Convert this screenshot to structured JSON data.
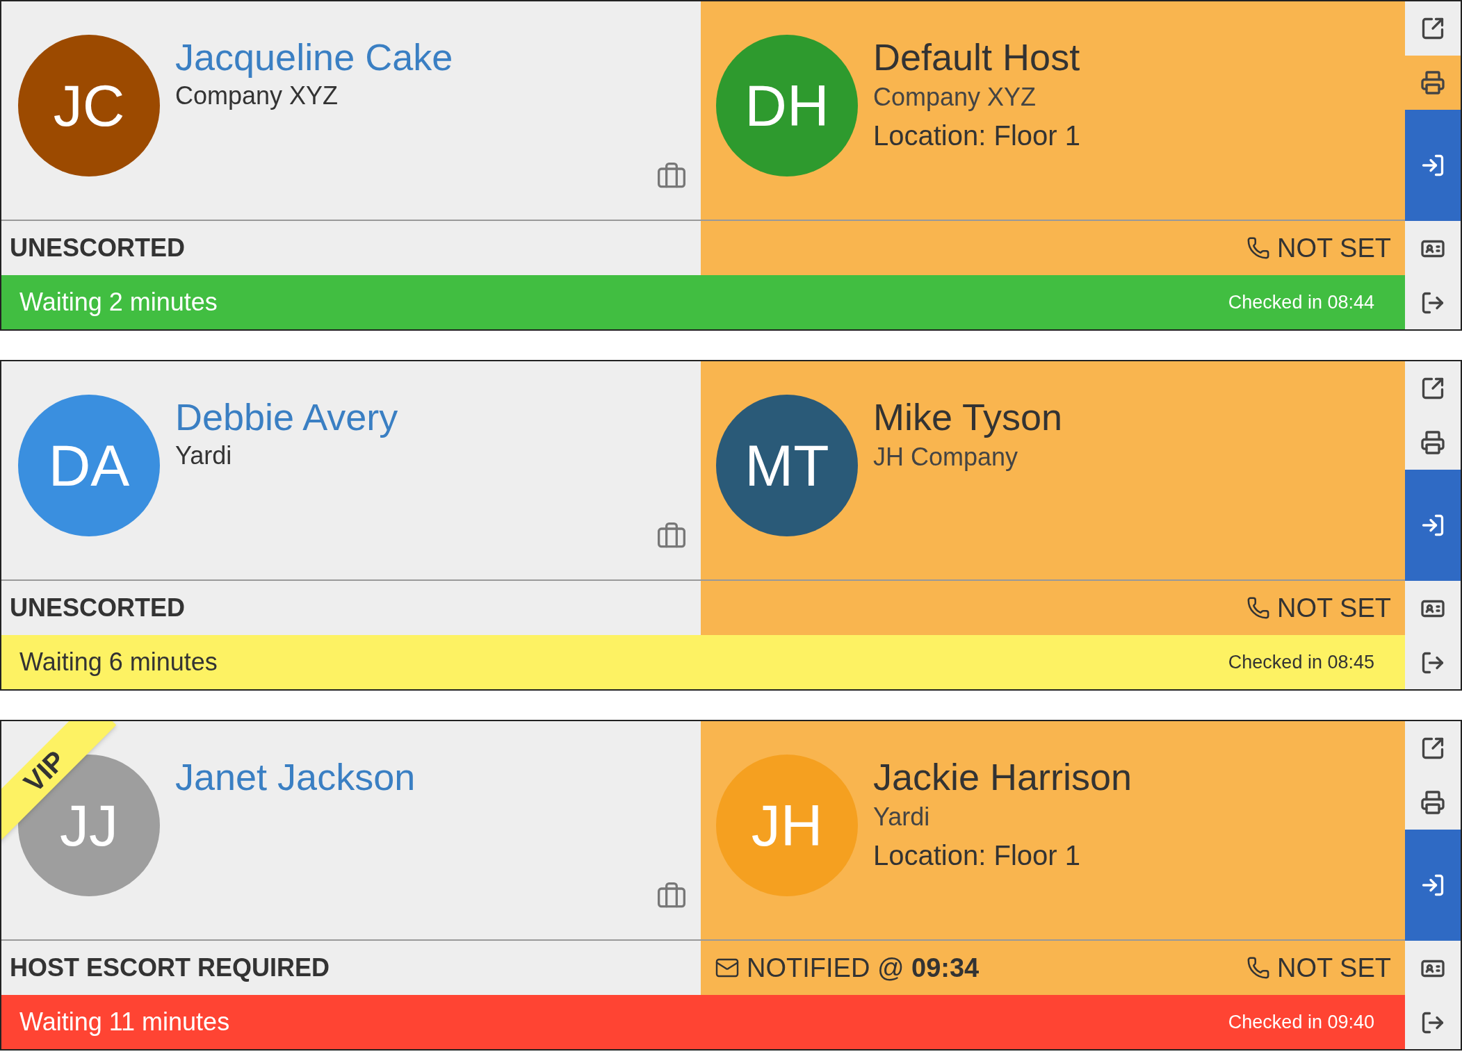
{
  "cards": [
    {
      "visitor": {
        "initials": "JC",
        "color": "#9c4a00",
        "name": "Jacqueline Cake",
        "company": "Company XYZ",
        "vip": false
      },
      "escort": "UNESCORTED",
      "host": {
        "initials": "DH",
        "color": "#2e9a2e",
        "name": "Default Host",
        "company": "Company XYZ",
        "location": "Location: Floor 1",
        "phone": "NOT SET"
      },
      "waiting": {
        "text": "Waiting 2 minutes",
        "checked_in": "Checked in 08:44",
        "color": "#41be41"
      },
      "actions": [
        {
          "kind": "edit",
          "highlighted": false
        },
        {
          "kind": "print",
          "highlighted": true
        },
        {
          "kind": "check-in",
          "highlighted": false
        },
        {
          "kind": "badge",
          "highlighted": false
        },
        {
          "kind": "check-out",
          "highlighted": false
        }
      ]
    },
    {
      "visitor": {
        "initials": "DA",
        "color": "#3a8fdf",
        "name": "Debbie Avery",
        "company": "Yardi",
        "vip": false
      },
      "escort": "UNESCORTED",
      "host": {
        "initials": "MT",
        "color": "#2a5a78",
        "name": "Mike Tyson",
        "company": "JH Company",
        "phone": "NOT SET"
      },
      "waiting": {
        "text": "Waiting 6 minutes",
        "checked_in": "Checked in 08:45",
        "color": "#fdf263"
      },
      "actions": [
        {
          "kind": "edit",
          "highlighted": false
        },
        {
          "kind": "print",
          "highlighted": false
        },
        {
          "kind": "check-in",
          "highlighted": false
        },
        {
          "kind": "badge",
          "highlighted": false
        },
        {
          "kind": "check-out",
          "highlighted": false
        }
      ]
    },
    {
      "visitor": {
        "initials": "JJ",
        "color": "#9e9e9e",
        "name": "Janet Jackson",
        "vip": true,
        "vip_label": "VIP"
      },
      "escort": "HOST ESCORT REQUIRED",
      "host": {
        "initials": "JH",
        "color": "#f5a020",
        "name": "Jackie Harrison",
        "company": "Yardi",
        "location": "Location: Floor 1",
        "notified": "NOTIFIED @ **09:34**",
        "phone": "NOT SET"
      },
      "waiting": {
        "text": "Waiting 11 minutes",
        "checked_in": "Checked in 09:40",
        "color": "#ff4433"
      },
      "actions": [
        {
          "kind": "edit",
          "highlighted": false
        },
        {
          "kind": "print",
          "highlighted": false
        },
        {
          "kind": "check-in",
          "highlighted": false
        },
        {
          "kind": "badge",
          "highlighted": false
        },
        {
          "kind": "check-out",
          "highlighted": false
        }
      ]
    }
  ]
}
